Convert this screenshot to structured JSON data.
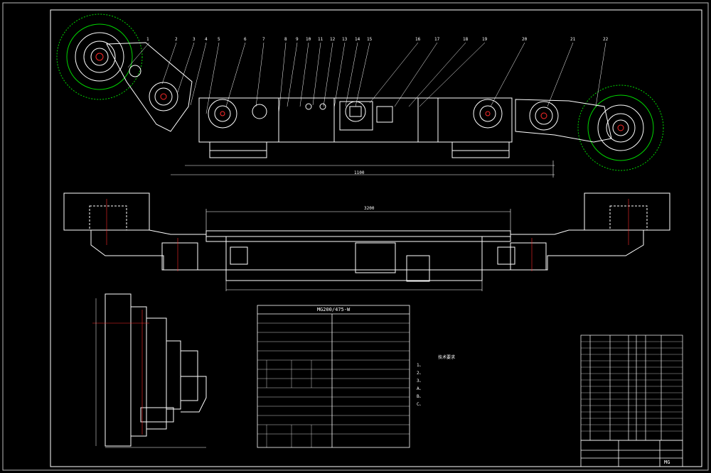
{
  "drawing": {
    "title": "MG200/475-W",
    "balloons": [
      "1",
      "2",
      "3",
      "4",
      "5",
      "6",
      "7",
      "8",
      "9",
      "10",
      "11",
      "12",
      "13",
      "14",
      "15",
      "16",
      "17",
      "18",
      "19",
      "20",
      "21",
      "22"
    ],
    "dimension_top": "1100",
    "dimension_plan": "3200",
    "spec_table_title": "MG200/475-W",
    "notes_heading": "技术要求",
    "notes_lines": [
      "1、",
      "2、",
      "3、",
      "A、",
      "B、",
      "C、"
    ],
    "title_block_code": "MG"
  },
  "colors": {
    "background": "#000000",
    "frame": "#ffffff",
    "geometry": "#ffffff",
    "centerline": "#ff2a2a",
    "cutter": "#00d800",
    "hidden": "#ffffff"
  }
}
